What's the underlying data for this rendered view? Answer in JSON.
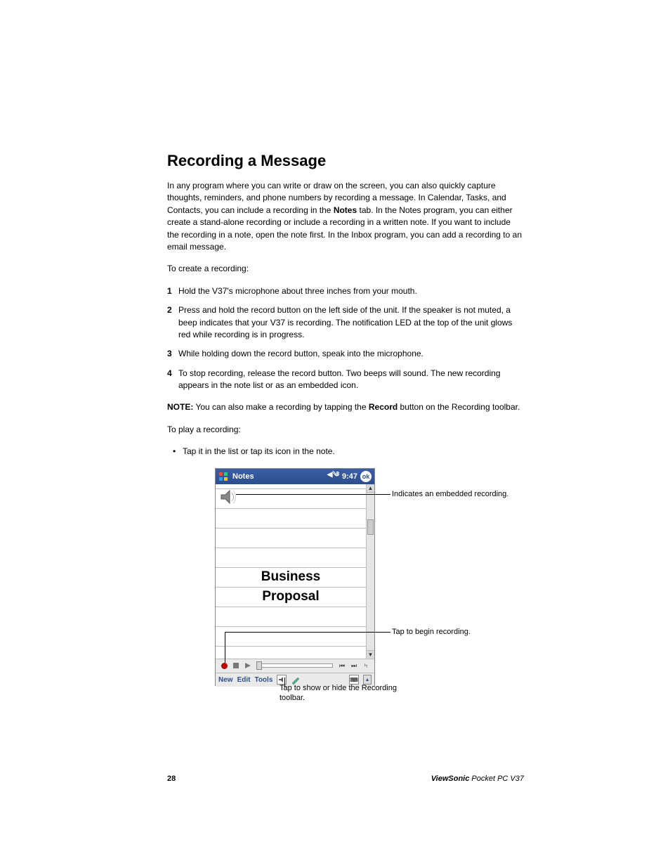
{
  "heading": "Recording a Message",
  "intro_pre": "In any program where you can write or draw on the screen, you can also quickly capture thoughts, reminders, and phone numbers by recording a message. In Calendar, Tasks, and Contacts, you can include a recording in the ",
  "intro_bold": "Notes",
  "intro_post": " tab. In the Notes program, you can either create a stand-alone recording or include a recording in a written note. If you want to include the recording in a note, open the note first. In the Inbox program, you can add a recording to an email message.",
  "create_label": "To create a recording:",
  "steps": [
    "Hold the V37's microphone about three inches from your mouth.",
    "Press and hold the record button on the left side of the unit. If the speaker is not muted, a beep indicates that your V37 is recording. The notification LED at the top of the unit glows red while recording is in progress.",
    "While holding down the record button, speak into the microphone.",
    "To stop recording, release the record button. Two beeps will sound. The new recording appears in the note list or as an embedded icon."
  ],
  "note_label": "NOTE:",
  "note_pre": " You can also make a recording by tapping the ",
  "note_bold": "Record",
  "note_post": " button on the Recording toolbar.",
  "play_label": "To play a recording:",
  "play_bullet": "Tap it in the list or tap its icon in the note.",
  "device": {
    "app_title": "Notes",
    "time": "9:47",
    "ok": "ok",
    "note_line1": "Business",
    "note_line2": "Proposal",
    "menu_new": "New",
    "menu_edit": "Edit",
    "menu_tools": "Tools"
  },
  "callouts": {
    "embedded": "Indicates an embedded recording.",
    "begin": "Tap to begin recording.",
    "toolbar": "Tap to show or hide the Recording toolbar."
  },
  "footer": {
    "page": "28",
    "brand": "ViewSonic",
    "model": " Pocket PC  V37"
  }
}
